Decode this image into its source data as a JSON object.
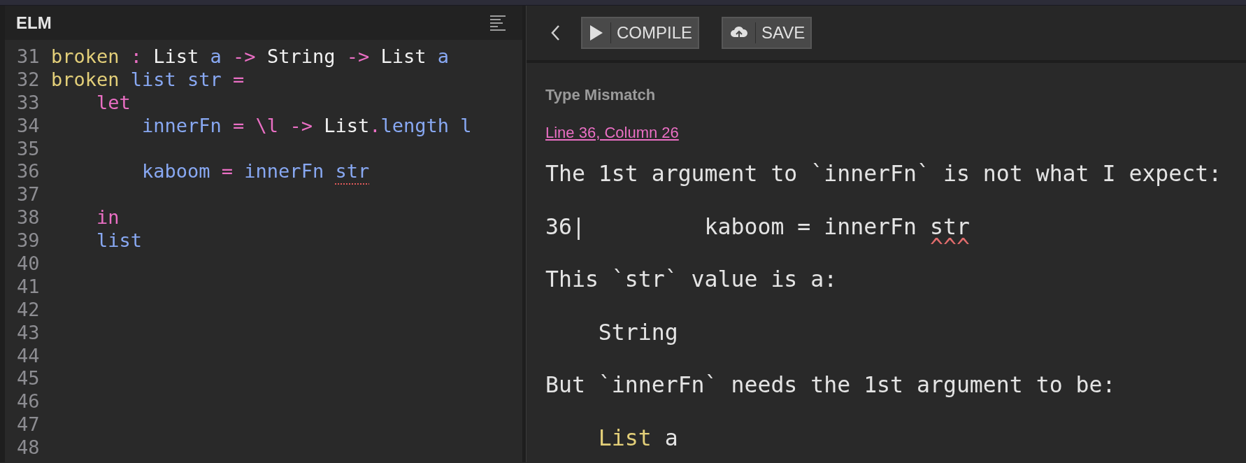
{
  "editor": {
    "title": "ELM",
    "lines": [
      {
        "number": "31",
        "tokens": [
          {
            "kind": "def",
            "text": "broken"
          },
          {
            "kind": "op",
            "text": " :"
          },
          {
            "kind": "type",
            "text": " List"
          },
          {
            "kind": "var",
            "text": " a"
          },
          {
            "kind": "op",
            "text": " ->"
          },
          {
            "kind": "type",
            "text": " String"
          },
          {
            "kind": "op",
            "text": " ->"
          },
          {
            "kind": "type",
            "text": " List"
          },
          {
            "kind": "var",
            "text": " a"
          }
        ]
      },
      {
        "number": "32",
        "tokens": [
          {
            "kind": "def",
            "text": "broken"
          },
          {
            "kind": "var",
            "text": " list"
          },
          {
            "kind": "var",
            "text": " str"
          },
          {
            "kind": "op",
            "text": " ="
          }
        ]
      },
      {
        "number": "33",
        "tokens": [
          {
            "kind": "keyword",
            "text": "    let"
          }
        ]
      },
      {
        "number": "34",
        "tokens": [
          {
            "kind": "var",
            "text": "        innerFn"
          },
          {
            "kind": "op",
            "text": " ="
          },
          {
            "kind": "op",
            "text": " \\l"
          },
          {
            "kind": "op",
            "text": " ->"
          },
          {
            "kind": "type",
            "text": " List"
          },
          {
            "kind": "op",
            "text": "."
          },
          {
            "kind": "var",
            "text": "length"
          },
          {
            "kind": "var",
            "text": " l"
          }
        ]
      },
      {
        "number": "35"
      },
      {
        "number": "36",
        "tokens": [
          {
            "kind": "var",
            "text": "        kaboom"
          },
          {
            "kind": "op",
            "text": " ="
          },
          {
            "kind": "var",
            "text": " innerFn "
          },
          {
            "kind": "var",
            "text": "str",
            "error": true
          }
        ]
      },
      {
        "number": "37"
      },
      {
        "number": "38",
        "tokens": [
          {
            "kind": "keyword",
            "text": "    in"
          }
        ]
      },
      {
        "number": "39",
        "tokens": [
          {
            "kind": "var",
            "text": "    list"
          }
        ]
      },
      {
        "number": "40"
      },
      {
        "number": "41"
      },
      {
        "number": "42"
      },
      {
        "number": "43"
      },
      {
        "number": "44"
      },
      {
        "number": "45"
      },
      {
        "number": "46"
      },
      {
        "number": "47"
      },
      {
        "number": "48"
      }
    ]
  },
  "toolbar": {
    "buttons": [
      {
        "kind": "compile",
        "label": "COMPILE"
      },
      {
        "kind": "save",
        "label": "SAVE"
      }
    ]
  },
  "error": {
    "title": "Type Mismatch",
    "location": "Line 36, Column 26",
    "blocks": [
      [
        [
          {
            "kind": "plain",
            "text": "The 1st argument to `innerFn` is not what I expect:"
          }
        ]
      ],
      [
        [
          {
            "kind": "plain",
            "text": "36|         kaboom = innerFn str"
          }
        ],
        [
          {
            "kind": "caret",
            "text": "                             ^^^"
          }
        ]
      ],
      [
        [
          {
            "kind": "plain",
            "text": "This `str` value is a:"
          }
        ]
      ],
      [
        [
          {
            "kind": "plain",
            "text": "    String"
          }
        ]
      ],
      [
        [
          {
            "kind": "plain",
            "text": "But `innerFn` needs the 1st argument to be:"
          }
        ]
      ],
      [
        [
          {
            "kind": "type",
            "text": "    List"
          },
          {
            "kind": "plain",
            "text": " a"
          }
        ]
      ]
    ]
  }
}
